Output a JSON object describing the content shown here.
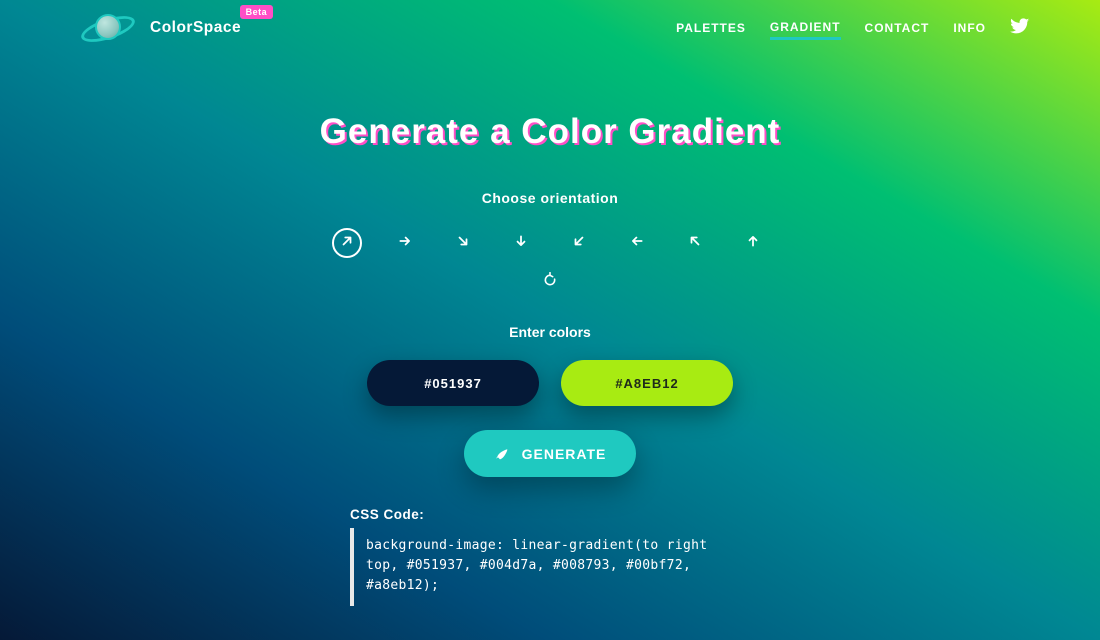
{
  "brand": {
    "name": "ColorSpace",
    "badge": "Beta"
  },
  "nav": {
    "items": [
      {
        "label": "PALETTES",
        "active": false
      },
      {
        "label": "GRADIENT",
        "active": true
      },
      {
        "label": "CONTACT",
        "active": false
      },
      {
        "label": "INFO",
        "active": false
      }
    ],
    "social": {
      "twitter": "twitter-icon"
    }
  },
  "headline": "Generate a Color Gradient",
  "orientation": {
    "label": "Choose orientation",
    "options": [
      {
        "name": "right-top",
        "selected": true
      },
      {
        "name": "right",
        "selected": false
      },
      {
        "name": "right-bottom",
        "selected": false
      },
      {
        "name": "bottom",
        "selected": false
      },
      {
        "name": "left-bottom",
        "selected": false
      },
      {
        "name": "left",
        "selected": false
      },
      {
        "name": "left-top",
        "selected": false
      },
      {
        "name": "top",
        "selected": false
      }
    ],
    "reset_icon": "rotate-icon"
  },
  "colors": {
    "label": "Enter colors",
    "color1": {
      "hex": "#051937"
    },
    "color2": {
      "hex": "#A8EB12"
    }
  },
  "generate_label": "GENERATE",
  "css_output": {
    "label": "CSS Code:",
    "code": "background-image: linear-gradient(to right top, #051937, #004d7a, #008793, #00bf72, #a8eb12);"
  },
  "gradient_stops": [
    "#051937",
    "#004d7a",
    "#008793",
    "#00bf72",
    "#a8eb12"
  ]
}
